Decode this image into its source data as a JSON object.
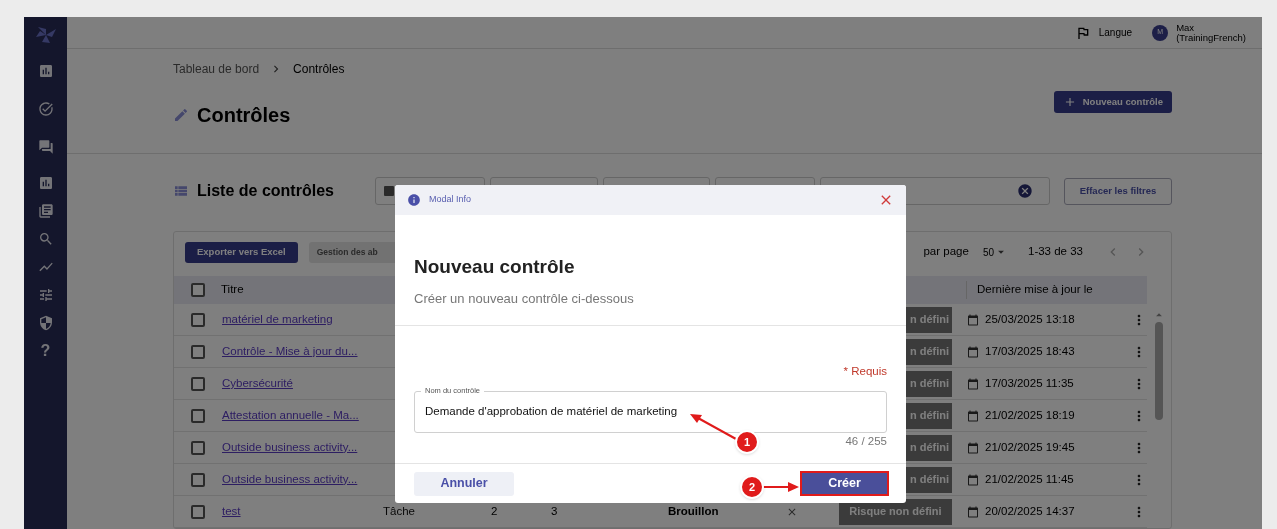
{
  "sidebar": {
    "help": "?"
  },
  "topbar": {
    "language": "Langue",
    "user": {
      "initial": "M",
      "name": "Max",
      "account": "(TrainingFrench)"
    }
  },
  "breadcrumb": [
    {
      "label": "Tableau de bord",
      "current": false
    },
    {
      "label": "Contrôles",
      "current": true
    }
  ],
  "page_title": "Contrôles",
  "new_button": "Nouveau contrôle",
  "list": {
    "title": "Liste de contrôles",
    "clear_filters": "Effacer les filtres",
    "export": "Exporter vers Excel",
    "manage": "Gestion des ab",
    "rows_per_page_label": "par page",
    "rows_per_page": "50",
    "range": "1-33 de 33"
  },
  "table": {
    "header_checked": false,
    "columns": [
      "Titre",
      "Dernière mise à jour le"
    ],
    "rows": [
      {
        "checked": false,
        "title": "matériel de marketing",
        "risk": "n défini",
        "updated": "25/03/2025 13:18"
      },
      {
        "checked": false,
        "title": "Contrôle - Mise à jour du...",
        "risk": "n défini",
        "updated": "17/03/2025 18:43"
      },
      {
        "checked": false,
        "title": "Cybersécurité",
        "risk": "n défini",
        "updated": "17/03/2025 11:35"
      },
      {
        "checked": false,
        "title": "Attestation annuelle - Ma...",
        "risk": "n défini",
        "updated": "21/02/2025 18:19"
      },
      {
        "checked": false,
        "title": "Outside business activity...",
        "risk": "n défini",
        "updated": "21/02/2025 19:45"
      },
      {
        "checked": false,
        "title": "Outside business activity...",
        "risk": "n défini",
        "updated": "21/02/2025 11:45"
      },
      {
        "checked": false,
        "title": "test",
        "type": "Tâche",
        "column_3": "2",
        "column_4": "3",
        "status": "Brouillon",
        "risk": "Risque non défini",
        "updated": "20/02/2025 14:37"
      }
    ]
  },
  "modal": {
    "header": "Modal Info",
    "title": "Nouveau contrôle",
    "subtitle": "Créer un nouveau contrôle ci-dessous",
    "required": "* Requis",
    "field": {
      "label": "Nom du contrôle",
      "value": "Demande d'approbation de matériel de marketing"
    },
    "counter": "46 / 255",
    "cancel": "Annuler",
    "submit": "Créer"
  },
  "annotations": [
    {
      "number": "1"
    },
    {
      "number": "2"
    }
  ]
}
